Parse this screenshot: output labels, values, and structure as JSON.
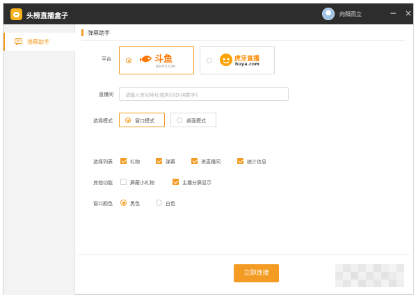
{
  "window": {
    "title": "头榜直播盒子",
    "username": "向阳而立",
    "minimize": "−",
    "close": "×"
  },
  "sidebar": {
    "items": [
      {
        "label": "弹幕助手",
        "icon": "danmaku-icon",
        "active": true
      }
    ]
  },
  "section": {
    "title": "弹幕助手"
  },
  "form": {
    "platform_label": "平台",
    "platforms": [
      {
        "name": "斗鱼",
        "sub": "DOUYU.COM",
        "selected": true
      },
      {
        "name": "虎牙直播",
        "sub": "huya.com",
        "selected": false
      }
    ],
    "room_label": "直播间",
    "room_placeholder": "请输入房间地址或房间ID(纯数字)",
    "mode_label": "选择模式",
    "modes": [
      {
        "label": "窗口模式",
        "selected": true
      },
      {
        "label": "桌面模式",
        "selected": false
      }
    ],
    "list_label": "选择列表",
    "list_options": [
      {
        "label": "礼物",
        "checked": true
      },
      {
        "label": "弹幕",
        "checked": true
      },
      {
        "label": "进直播间",
        "checked": true
      },
      {
        "label": "统计信息",
        "checked": true
      }
    ],
    "other_label": "其他功能",
    "other_options": [
      {
        "label": "屏蔽小礼物",
        "checked": false
      },
      {
        "label": "主播分屏显示",
        "checked": true
      }
    ],
    "color_label": "窗口颜色",
    "color_options": [
      {
        "label": "黑色",
        "selected": true
      },
      {
        "label": "白色",
        "selected": false
      }
    ]
  },
  "actions": {
    "connect_label": "立即连接"
  },
  "colors": {
    "accent": "#f39b22",
    "titlebar": "#2d2d2d",
    "douyu": "#ff7700",
    "huya": "#ffa200"
  }
}
